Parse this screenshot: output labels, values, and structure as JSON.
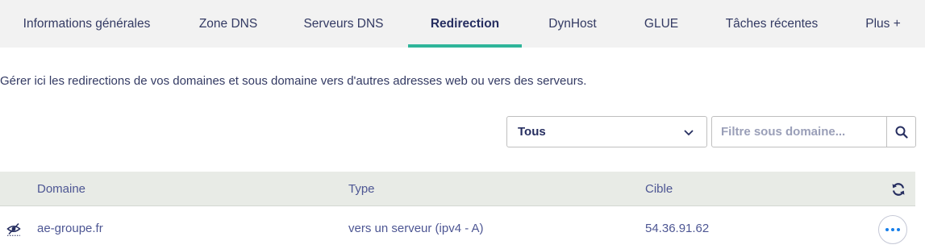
{
  "tabs": [
    {
      "label": "Informations générales",
      "active": false
    },
    {
      "label": "Zone DNS",
      "active": false
    },
    {
      "label": "Serveurs DNS",
      "active": false
    },
    {
      "label": "Redirection",
      "active": true
    },
    {
      "label": "DynHost",
      "active": false
    },
    {
      "label": "GLUE",
      "active": false
    },
    {
      "label": "Tâches récentes",
      "active": false
    },
    {
      "label": "Plus +",
      "active": false
    }
  ],
  "description": "Gérer ici les redirections de vos domaines et sous domaine vers d'autres adresses web ou vers des serveurs.",
  "filter": {
    "select_value": "Tous",
    "search_placeholder": "Filtre sous domaine..."
  },
  "table": {
    "headers": {
      "domain": "Domaine",
      "type": "Type",
      "target": "Cible"
    },
    "rows": [
      {
        "domain": "ae-groupe.fr",
        "type": "vers un serveur (ipv4 - A)",
        "target": "54.36.91.62"
      }
    ]
  },
  "colors": {
    "accent": "#2fb59a",
    "text": "#4d5693",
    "header_bg": "#e8ebe6",
    "link": "#157eea"
  },
  "icons": [
    "chevron-down-icon",
    "search-icon",
    "refresh-icon",
    "eye-slash-icon",
    "more-icon"
  ]
}
